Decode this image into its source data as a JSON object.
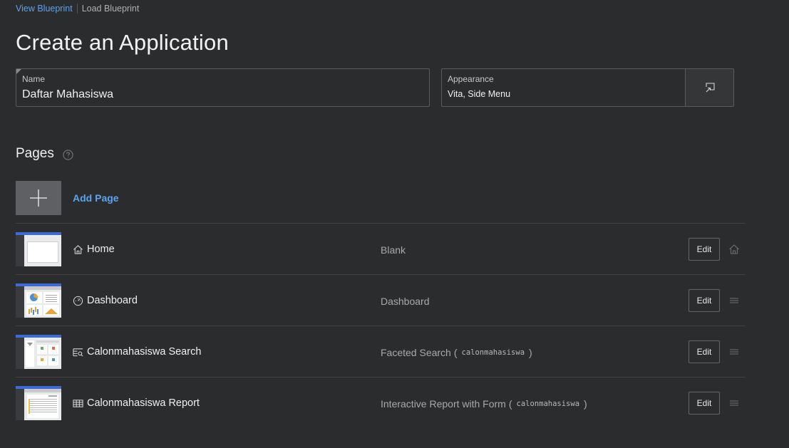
{
  "top_links": {
    "view_blueprint": "View Blueprint",
    "load_blueprint": "Load Blueprint"
  },
  "title": "Create an Application",
  "name_field": {
    "label": "Name",
    "value": "Daftar Mahasiswa"
  },
  "appearance_field": {
    "label": "Appearance",
    "value": "Vita, Side Menu",
    "button_icon": "open-dialog-icon"
  },
  "pages_section": {
    "title": "Pages",
    "help_icon": "help-icon",
    "add_page_label": "Add Page"
  },
  "pages": [
    {
      "name": "Home",
      "icon": "home-icon",
      "type": "Blank",
      "source": "",
      "edit_label": "Edit",
      "end_icon": "home-icon"
    },
    {
      "name": "Dashboard",
      "icon": "gauge-icon",
      "type": "Dashboard",
      "source": "",
      "edit_label": "Edit",
      "end_icon": "drag-handle-icon"
    },
    {
      "name": "Calonmahasiswa Search",
      "icon": "faceted-search-icon",
      "type": "Faceted Search",
      "source": "calonmahasiswa",
      "edit_label": "Edit",
      "end_icon": "drag-handle-icon"
    },
    {
      "name": "Calonmahasiswa Report",
      "icon": "report-table-icon",
      "type": "Interactive Report with Form",
      "source": "calonmahasiswa",
      "edit_label": "Edit",
      "end_icon": "drag-handle-icon"
    }
  ],
  "colors": {
    "background": "#2b2c2e",
    "link": "#5aa3f0",
    "thumb_header": "#3d6bd6"
  }
}
